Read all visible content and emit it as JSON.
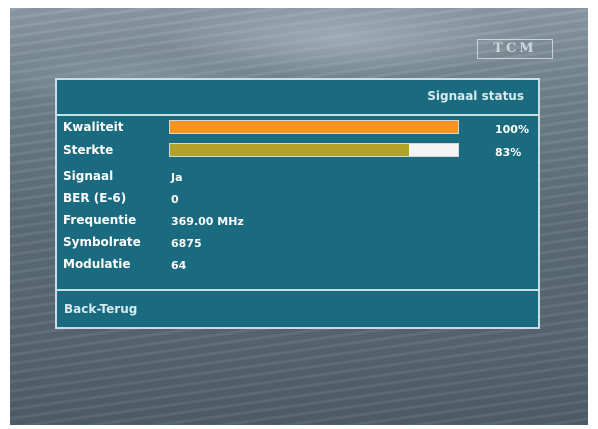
{
  "logo": {
    "text": "TCM"
  },
  "panel": {
    "title": "Signaal status",
    "quality": {
      "label": "Kwaliteit",
      "percent": 100,
      "percent_text": "100%",
      "color": "#f7941d"
    },
    "strength": {
      "label": "Sterkte",
      "percent": 83,
      "percent_text": "83%",
      "color": "#b3a22a"
    },
    "fields": [
      {
        "label": "Signaal",
        "value": "Ja"
      },
      {
        "label": "BER (E-6)",
        "value": "0"
      },
      {
        "label": "Frequentie",
        "value": "369.00 MHz"
      },
      {
        "label": "Symbolrate",
        "value": "6875"
      },
      {
        "label": "Modulatie",
        "value": "64"
      }
    ],
    "footer": {
      "back_label": "Back-Terug"
    }
  },
  "colors": {
    "panel_background": "#1a6a80",
    "panel_border": "#c9dde3"
  }
}
